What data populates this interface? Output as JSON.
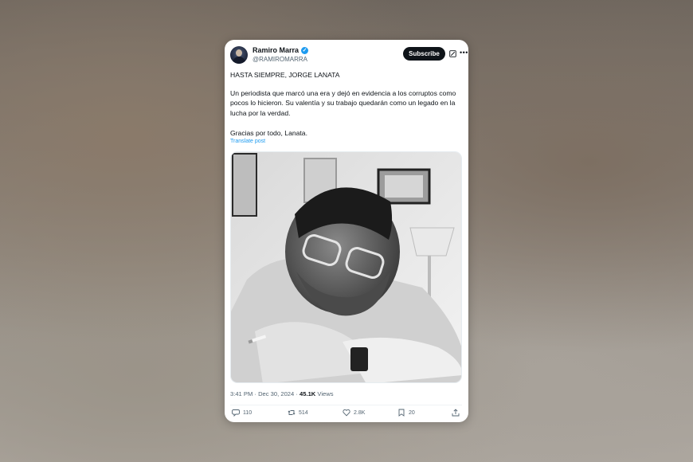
{
  "author": {
    "name": "Ramiro Marra",
    "handle": "@RAMIROMARRA",
    "verified": true
  },
  "header": {
    "subscribe_label": "Subscribe",
    "grok_icon": "grok-icon",
    "more_icon": "more-icon"
  },
  "post": {
    "paragraph_1": "HASTA SIEMPRE, JORGE LANATA",
    "paragraph_2": "Un periodista que marcó una era y dejó en evidencia a los corruptos como pocos lo hicieron. Su valentía y su trabajo quedarán como un legado en la lucha por la verdad.",
    "paragraph_3": "Gracias por todo, Lanata.",
    "translate_label": "Translate post",
    "image_description_icon": "photo"
  },
  "meta": {
    "time": "3:41 PM",
    "separator": "·",
    "date": "Dec 30, 2024",
    "views_count": "45.1K",
    "views_label": "Views"
  },
  "actions": {
    "replies": "110",
    "reposts": "514",
    "likes": "2.8K",
    "bookmarks": "20"
  },
  "colors": {
    "accent": "#1d9bf0",
    "text": "#0f1419",
    "secondary": "#536471"
  }
}
